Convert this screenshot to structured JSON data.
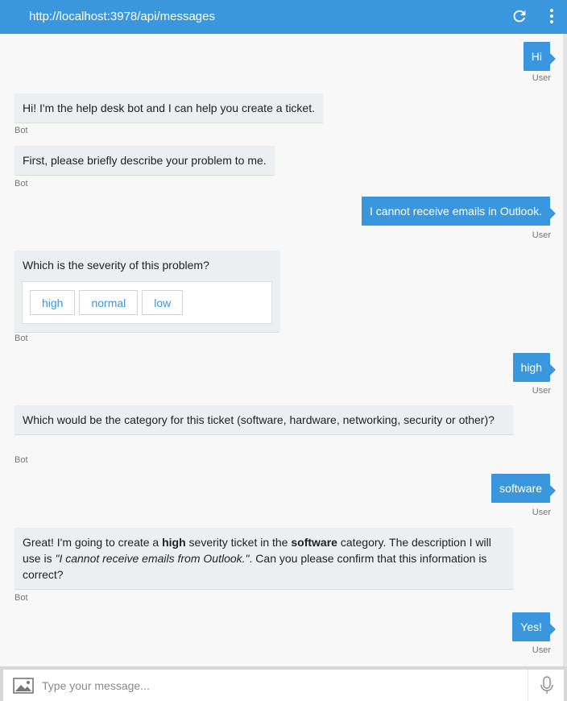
{
  "header": {
    "title": "http://localhost:3978/api/messages",
    "refresh_icon": "refresh-icon",
    "menu_icon": "more-vertical-icon"
  },
  "colors": {
    "accent": "#3a96dd",
    "bot_bubble": "#eceff1"
  },
  "messages": [
    {
      "from": "User",
      "text": "Hi",
      "meta": "User"
    },
    {
      "from": "Bot",
      "text": "Hi! I'm the help desk bot and I can help you create a ticket.",
      "meta": "Bot"
    },
    {
      "from": "Bot",
      "text": "First, please briefly describe your problem to me.",
      "meta": "Bot"
    },
    {
      "from": "User",
      "text": "I cannot receive emails in Outlook.",
      "meta": "User"
    },
    {
      "from": "Bot",
      "text": "Which is the severity of this problem?",
      "meta": "Bot",
      "buttons": [
        "high",
        "normal",
        "low"
      ]
    },
    {
      "from": "User",
      "text": "high",
      "meta": "User"
    },
    {
      "from": "Bot",
      "text": "Which would be the category for this ticket (software, hardware, networking, security or other)?",
      "meta": "Bot"
    },
    {
      "from": "User",
      "text": "software",
      "meta": "User"
    },
    {
      "from": "Bot",
      "meta": "Bot",
      "parts": {
        "p1": "Great! I'm going to create a ",
        "b1": "high",
        "p2": " severity ticket in the ",
        "b2": "software",
        "p3": " category. The description I will use is ",
        "i1": "\"I cannot receive emails from Outlook.\"",
        "p4": ". Can you please confirm that this information is correct?"
      }
    },
    {
      "from": "User",
      "text": "Yes!",
      "meta": "User"
    }
  ],
  "composer": {
    "placeholder": "Type your message...",
    "upload_icon": "image-upload-icon",
    "mic_icon": "microphone-icon"
  }
}
